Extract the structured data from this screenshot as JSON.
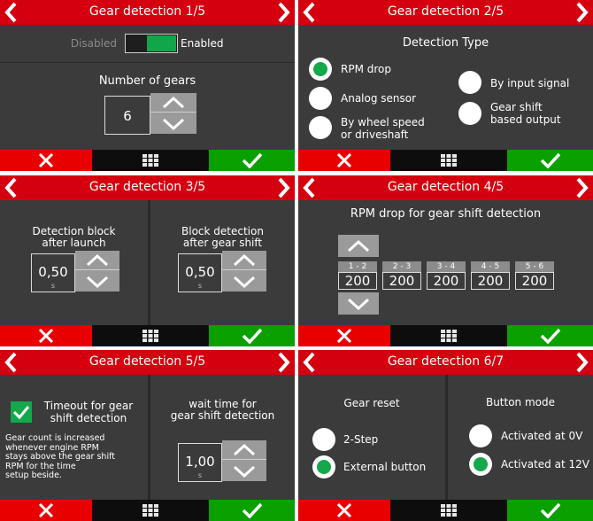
{
  "panels": [
    {
      "title": "Gear detection 1/5",
      "toggle": {
        "off_label": "Disabled",
        "on_label": "Enabled"
      },
      "gears_label": "Number of gears",
      "gears_value": "6"
    },
    {
      "title": "Gear detection 2/5",
      "heading": "Detection Type",
      "options": [
        {
          "label": "RPM drop",
          "selected": true
        },
        {
          "label": "Analog sensor",
          "selected": false
        },
        {
          "label": "By wheel speed\nor driveshaft",
          "selected": false
        },
        {
          "label": "By input signal",
          "selected": false
        },
        {
          "label": "Gear shift\nbased output",
          "selected": false
        }
      ]
    },
    {
      "title": "Gear detection 3/5",
      "left": {
        "label": "Detection block\nafter launch",
        "value": "0,50",
        "unit": "s"
      },
      "right": {
        "label": "Block detection\nafter gear shift",
        "value": "0,50",
        "unit": "s"
      }
    },
    {
      "title": "Gear detection 4/5",
      "heading": "RPM drop for gear shift detection",
      "gears": [
        {
          "label": "1 - 2",
          "value": "200"
        },
        {
          "label": "2 - 3",
          "value": "200"
        },
        {
          "label": "3 - 4",
          "value": "200"
        },
        {
          "label": "4 - 5",
          "value": "200"
        },
        {
          "label": "5 - 6",
          "value": "200"
        }
      ]
    },
    {
      "title": "Gear detection 5/5",
      "timeout_label": "Timeout for gear\nshift detection",
      "description": "Gear count is increased\nwhenever engine RPM\nstays above the gear shift\nRPM for the time\nsetup beside.",
      "wait_label": "wait time for\ngear shift detection",
      "wait_value": "1,00",
      "wait_unit": "s"
    },
    {
      "title": "Gear detection 6/7",
      "reset_heading": "Gear reset",
      "reset_options": [
        {
          "label": "2-Step",
          "selected": false
        },
        {
          "label": "External button",
          "selected": true
        }
      ],
      "mode_heading": "Button mode",
      "mode_options": [
        {
          "label": "Activated at 0V",
          "selected": false
        },
        {
          "label": "Activated at 12V",
          "selected": true
        }
      ]
    }
  ],
  "colors": {
    "titlebar": "#d4000f",
    "cancel": "#e80000",
    "ok": "#0aa000",
    "selected": "#13a84a",
    "panel": "#3b3b3b"
  },
  "icons": {
    "prev": "chevron-left-icon",
    "next": "chevron-right-icon",
    "cancel": "x-icon",
    "menu": "grid-icon",
    "confirm": "checkmark-icon",
    "up": "chevron-up-icon",
    "down": "chevron-down-icon"
  }
}
